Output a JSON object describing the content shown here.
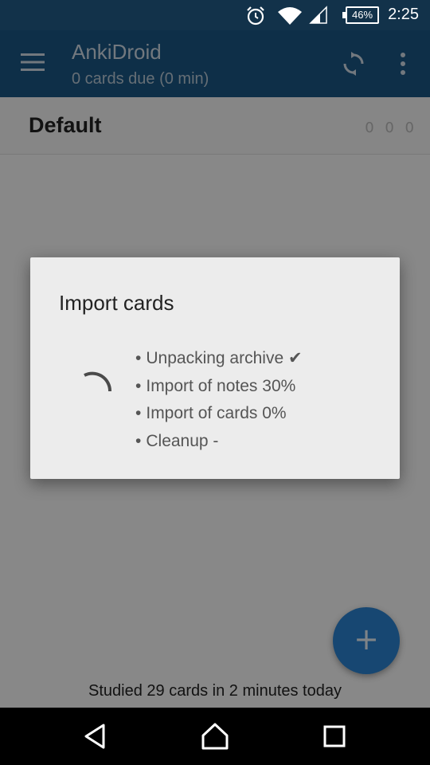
{
  "status_bar": {
    "time": "2:25",
    "battery": "46%"
  },
  "toolbar": {
    "title": "AnkiDroid",
    "subtitle": "0 cards due (0 min)"
  },
  "deck": {
    "name": "Default",
    "counts": "0 0 0"
  },
  "footer": {
    "studied": "Studied 29 cards in 2 minutes today"
  },
  "fab": {
    "label": "+"
  },
  "dialog": {
    "title": "Import cards",
    "bullet": "•",
    "steps": [
      "Unpacking archive ✔",
      "Import of notes 30%",
      "Import of cards 0%",
      "Cleanup -"
    ]
  },
  "colors": {
    "status_bar": "#12324a",
    "toolbar": "#1a5784",
    "fab": "#2a82d0",
    "dialog": "#ececec"
  },
  "icons": [
    "alarm-icon",
    "wifi-icon",
    "signal-icon",
    "battery-icon",
    "menu-icon",
    "sync-icon",
    "overflow-icon",
    "back-icon",
    "home-icon",
    "recents-icon",
    "spinner-icon"
  ]
}
